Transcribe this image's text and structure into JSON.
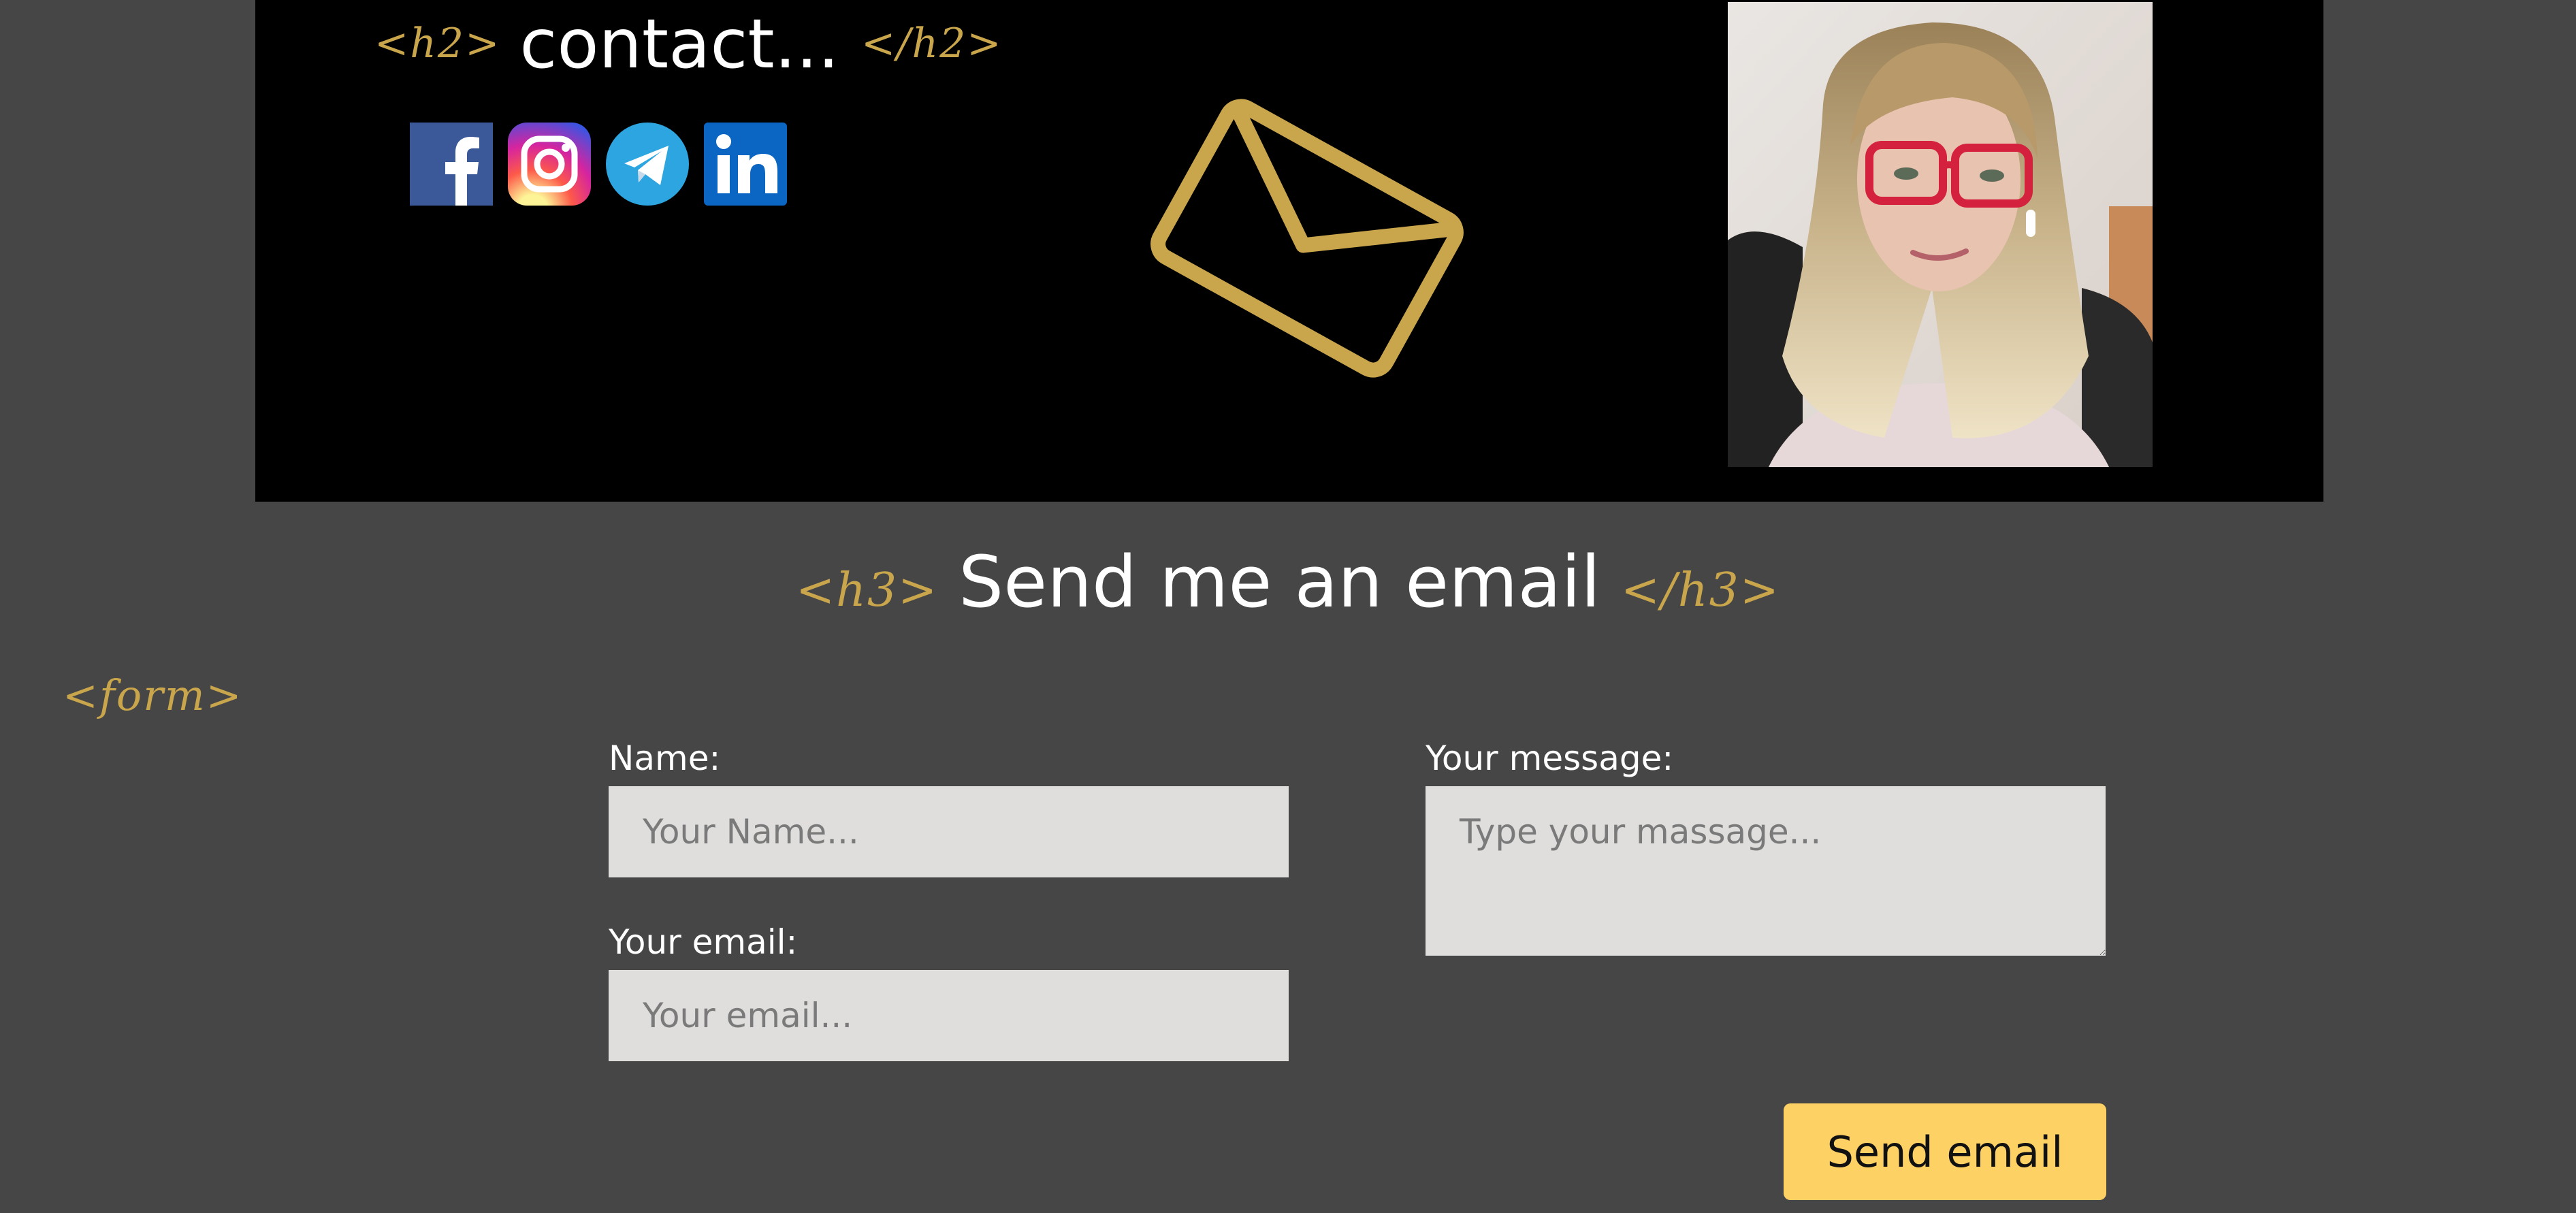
{
  "contact": {
    "h2_open": "<h2>",
    "title": "contact...",
    "h2_close": "</h2>",
    "socials": [
      {
        "icon": "facebook-icon",
        "color": "#3b5998"
      },
      {
        "icon": "instagram-icon",
        "color": "#d6249f"
      },
      {
        "icon": "telegram-icon",
        "color": "#2ca5e0"
      },
      {
        "icon": "linkedin-icon",
        "color": "#0a66c2"
      }
    ],
    "envelope_icon": "envelope-icon",
    "accent_color": "#c9a54c"
  },
  "email_section": {
    "h3_open": "<h3>",
    "title": "Send me an email",
    "h3_close": "</h3>"
  },
  "form": {
    "tag": "<form>",
    "name_label": "Name:",
    "name_placeholder": "Your Name...",
    "email_label": "Your email:",
    "email_placeholder": "Your email...",
    "message_label": "Your message:",
    "message_placeholder": "Type your massage...",
    "submit_label": "Send email",
    "submit_color": "#fdd164"
  }
}
